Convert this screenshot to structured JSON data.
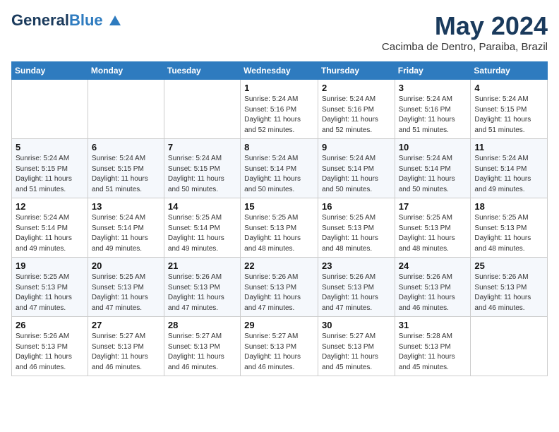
{
  "logo": {
    "general": "General",
    "blue": "Blue"
  },
  "title": {
    "month_year": "May 2024",
    "location": "Cacimba de Dentro, Paraiba, Brazil"
  },
  "headers": [
    "Sunday",
    "Monday",
    "Tuesday",
    "Wednesday",
    "Thursday",
    "Friday",
    "Saturday"
  ],
  "weeks": [
    [
      {
        "num": "",
        "info": ""
      },
      {
        "num": "",
        "info": ""
      },
      {
        "num": "",
        "info": ""
      },
      {
        "num": "1",
        "info": "Sunrise: 5:24 AM\nSunset: 5:16 PM\nDaylight: 11 hours\nand 52 minutes."
      },
      {
        "num": "2",
        "info": "Sunrise: 5:24 AM\nSunset: 5:16 PM\nDaylight: 11 hours\nand 52 minutes."
      },
      {
        "num": "3",
        "info": "Sunrise: 5:24 AM\nSunset: 5:16 PM\nDaylight: 11 hours\nand 51 minutes."
      },
      {
        "num": "4",
        "info": "Sunrise: 5:24 AM\nSunset: 5:15 PM\nDaylight: 11 hours\nand 51 minutes."
      }
    ],
    [
      {
        "num": "5",
        "info": "Sunrise: 5:24 AM\nSunset: 5:15 PM\nDaylight: 11 hours\nand 51 minutes."
      },
      {
        "num": "6",
        "info": "Sunrise: 5:24 AM\nSunset: 5:15 PM\nDaylight: 11 hours\nand 51 minutes."
      },
      {
        "num": "7",
        "info": "Sunrise: 5:24 AM\nSunset: 5:15 PM\nDaylight: 11 hours\nand 50 minutes."
      },
      {
        "num": "8",
        "info": "Sunrise: 5:24 AM\nSunset: 5:14 PM\nDaylight: 11 hours\nand 50 minutes."
      },
      {
        "num": "9",
        "info": "Sunrise: 5:24 AM\nSunset: 5:14 PM\nDaylight: 11 hours\nand 50 minutes."
      },
      {
        "num": "10",
        "info": "Sunrise: 5:24 AM\nSunset: 5:14 PM\nDaylight: 11 hours\nand 50 minutes."
      },
      {
        "num": "11",
        "info": "Sunrise: 5:24 AM\nSunset: 5:14 PM\nDaylight: 11 hours\nand 49 minutes."
      }
    ],
    [
      {
        "num": "12",
        "info": "Sunrise: 5:24 AM\nSunset: 5:14 PM\nDaylight: 11 hours\nand 49 minutes."
      },
      {
        "num": "13",
        "info": "Sunrise: 5:24 AM\nSunset: 5:14 PM\nDaylight: 11 hours\nand 49 minutes."
      },
      {
        "num": "14",
        "info": "Sunrise: 5:25 AM\nSunset: 5:14 PM\nDaylight: 11 hours\nand 49 minutes."
      },
      {
        "num": "15",
        "info": "Sunrise: 5:25 AM\nSunset: 5:13 PM\nDaylight: 11 hours\nand 48 minutes."
      },
      {
        "num": "16",
        "info": "Sunrise: 5:25 AM\nSunset: 5:13 PM\nDaylight: 11 hours\nand 48 minutes."
      },
      {
        "num": "17",
        "info": "Sunrise: 5:25 AM\nSunset: 5:13 PM\nDaylight: 11 hours\nand 48 minutes."
      },
      {
        "num": "18",
        "info": "Sunrise: 5:25 AM\nSunset: 5:13 PM\nDaylight: 11 hours\nand 48 minutes."
      }
    ],
    [
      {
        "num": "19",
        "info": "Sunrise: 5:25 AM\nSunset: 5:13 PM\nDaylight: 11 hours\nand 47 minutes."
      },
      {
        "num": "20",
        "info": "Sunrise: 5:25 AM\nSunset: 5:13 PM\nDaylight: 11 hours\nand 47 minutes."
      },
      {
        "num": "21",
        "info": "Sunrise: 5:26 AM\nSunset: 5:13 PM\nDaylight: 11 hours\nand 47 minutes."
      },
      {
        "num": "22",
        "info": "Sunrise: 5:26 AM\nSunset: 5:13 PM\nDaylight: 11 hours\nand 47 minutes."
      },
      {
        "num": "23",
        "info": "Sunrise: 5:26 AM\nSunset: 5:13 PM\nDaylight: 11 hours\nand 47 minutes."
      },
      {
        "num": "24",
        "info": "Sunrise: 5:26 AM\nSunset: 5:13 PM\nDaylight: 11 hours\nand 46 minutes."
      },
      {
        "num": "25",
        "info": "Sunrise: 5:26 AM\nSunset: 5:13 PM\nDaylight: 11 hours\nand 46 minutes."
      }
    ],
    [
      {
        "num": "26",
        "info": "Sunrise: 5:26 AM\nSunset: 5:13 PM\nDaylight: 11 hours\nand 46 minutes."
      },
      {
        "num": "27",
        "info": "Sunrise: 5:27 AM\nSunset: 5:13 PM\nDaylight: 11 hours\nand 46 minutes."
      },
      {
        "num": "28",
        "info": "Sunrise: 5:27 AM\nSunset: 5:13 PM\nDaylight: 11 hours\nand 46 minutes."
      },
      {
        "num": "29",
        "info": "Sunrise: 5:27 AM\nSunset: 5:13 PM\nDaylight: 11 hours\nand 46 minutes."
      },
      {
        "num": "30",
        "info": "Sunrise: 5:27 AM\nSunset: 5:13 PM\nDaylight: 11 hours\nand 45 minutes."
      },
      {
        "num": "31",
        "info": "Sunrise: 5:28 AM\nSunset: 5:13 PM\nDaylight: 11 hours\nand 45 minutes."
      },
      {
        "num": "",
        "info": ""
      }
    ]
  ]
}
